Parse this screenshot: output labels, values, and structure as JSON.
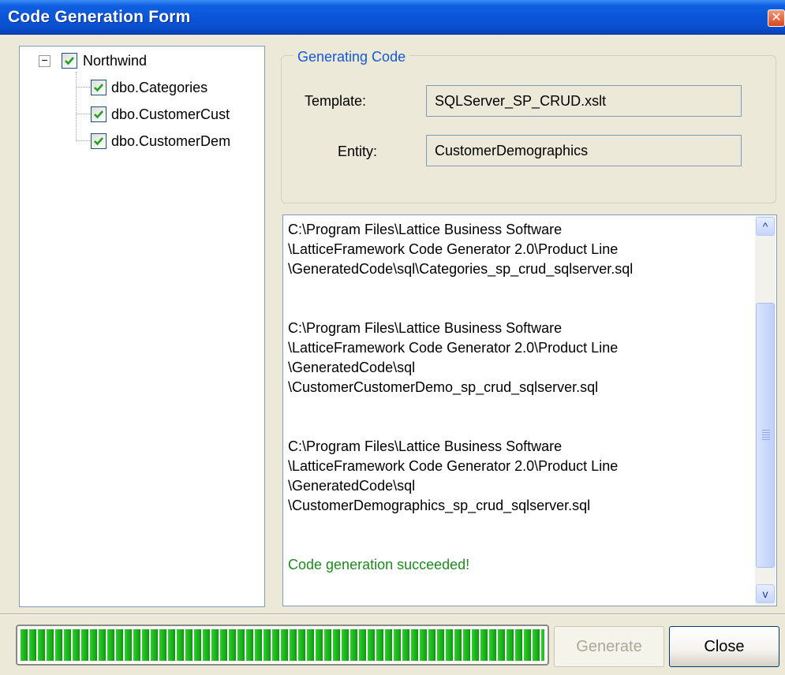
{
  "window": {
    "title": "Code Generation Form",
    "close_glyph": "✕"
  },
  "tree": {
    "root": {
      "label": "Northwind",
      "checked": true,
      "expander": "−"
    },
    "children": [
      {
        "label": "dbo.Categories",
        "checked": true
      },
      {
        "label": "dbo.CustomerCust",
        "checked": true
      },
      {
        "label": "dbo.CustomerDem",
        "checked": true
      }
    ],
    "scroll_left_glyph": "<",
    "scroll_right_glyph": ">"
  },
  "group": {
    "legend": "Generating Code",
    "template_label": "Template:",
    "template_value": "SQLServer_SP_CRUD.xslt",
    "entity_label": "Entity:",
    "entity_value": "CustomerDemographics"
  },
  "output": {
    "lines": [
      "C:\\Program Files\\Lattice Business Software",
      "\\LatticeFramework Code Generator 2.0\\Product Line",
      "\\GeneratedCode\\sql\\Categories_sp_crud_sqlserver.sql",
      "",
      "C:\\Program Files\\Lattice Business Software",
      "\\LatticeFramework Code Generator 2.0\\Product Line",
      "\\GeneratedCode\\sql",
      "\\CustomerCustomerDemo_sp_crud_sqlserver.sql",
      "",
      "C:\\Program Files\\Lattice Business Software",
      "\\LatticeFramework Code Generator 2.0\\Product Line",
      "\\GeneratedCode\\sql",
      "\\CustomerDemographics_sp_crud_sqlserver.sql",
      ""
    ],
    "status": "Code generation succeeded!",
    "status_color": "#1E8A1E",
    "scroll_up_glyph": "^",
    "scroll_down_glyph": "v"
  },
  "footer": {
    "progress_fraction": 1.0,
    "generate_label": "Generate",
    "close_label": "Close"
  },
  "colors": {
    "titlebar": "#0C55D8",
    "progress": "#21BE21",
    "legend": "#1559D0"
  }
}
